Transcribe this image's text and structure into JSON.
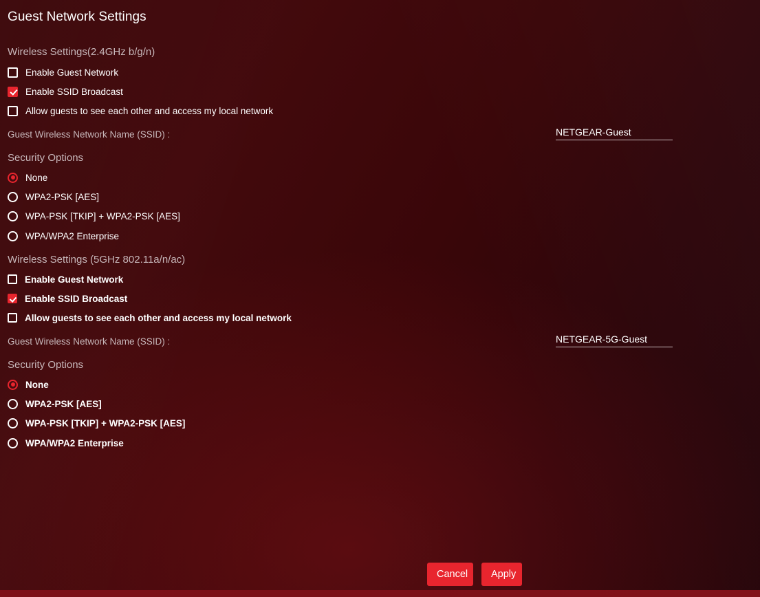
{
  "page": {
    "title": "Guest Network Settings",
    "accent_color": "#e8252e",
    "background_color": "#3a0609",
    "heading_color": "#c8b8bb",
    "text_color": "#ffffff"
  },
  "sections": [
    {
      "heading": "Wireless Settings(2.4GHz b/g/n)",
      "checkboxes": [
        {
          "label": "Enable Guest Network",
          "checked": false
        },
        {
          "label": "Enable SSID Broadcast",
          "checked": true
        },
        {
          "label": "Allow guests to see each other and access my local network",
          "checked": false
        }
      ],
      "ssid": {
        "label": "Guest Wireless Network Name (SSID) :",
        "value": "NETGEAR-Guest",
        "placeholder": "NETGEAR-Guest"
      },
      "security": {
        "heading": "Security Options",
        "selected": "None",
        "options": [
          {
            "label": "None",
            "selected": true
          },
          {
            "label": "WPA2-PSK [AES]",
            "selected": false
          },
          {
            "label": "WPA-PSK [TKIP] + WPA2-PSK [AES]",
            "selected": false
          },
          {
            "label": "WPA/WPA2 Enterprise",
            "selected": false
          }
        ]
      }
    },
    {
      "heading": "Wireless Settings (5GHz 802.11a/n/ac)",
      "checkboxes": [
        {
          "label": "Enable Guest Network",
          "checked": false
        },
        {
          "label": "Enable SSID Broadcast",
          "checked": true
        },
        {
          "label": "Allow guests to see each other and access my local network",
          "checked": false
        }
      ],
      "ssid": {
        "label": "Guest Wireless Network Name (SSID) :",
        "value": "NETGEAR-5G-Guest",
        "placeholder": "NETGEAR-5G-Guest"
      },
      "security": {
        "heading": "Security Options",
        "selected": "None",
        "options": [
          {
            "label": "None",
            "selected": true
          },
          {
            "label": "WPA2-PSK [AES]",
            "selected": false
          },
          {
            "label": "WPA-PSK [TKIP] + WPA2-PSK [AES]",
            "selected": false
          },
          {
            "label": "WPA/WPA2 Enterprise",
            "selected": false
          }
        ]
      }
    }
  ],
  "footer": {
    "cancel_label": "Cancel",
    "apply_label": "Apply"
  }
}
